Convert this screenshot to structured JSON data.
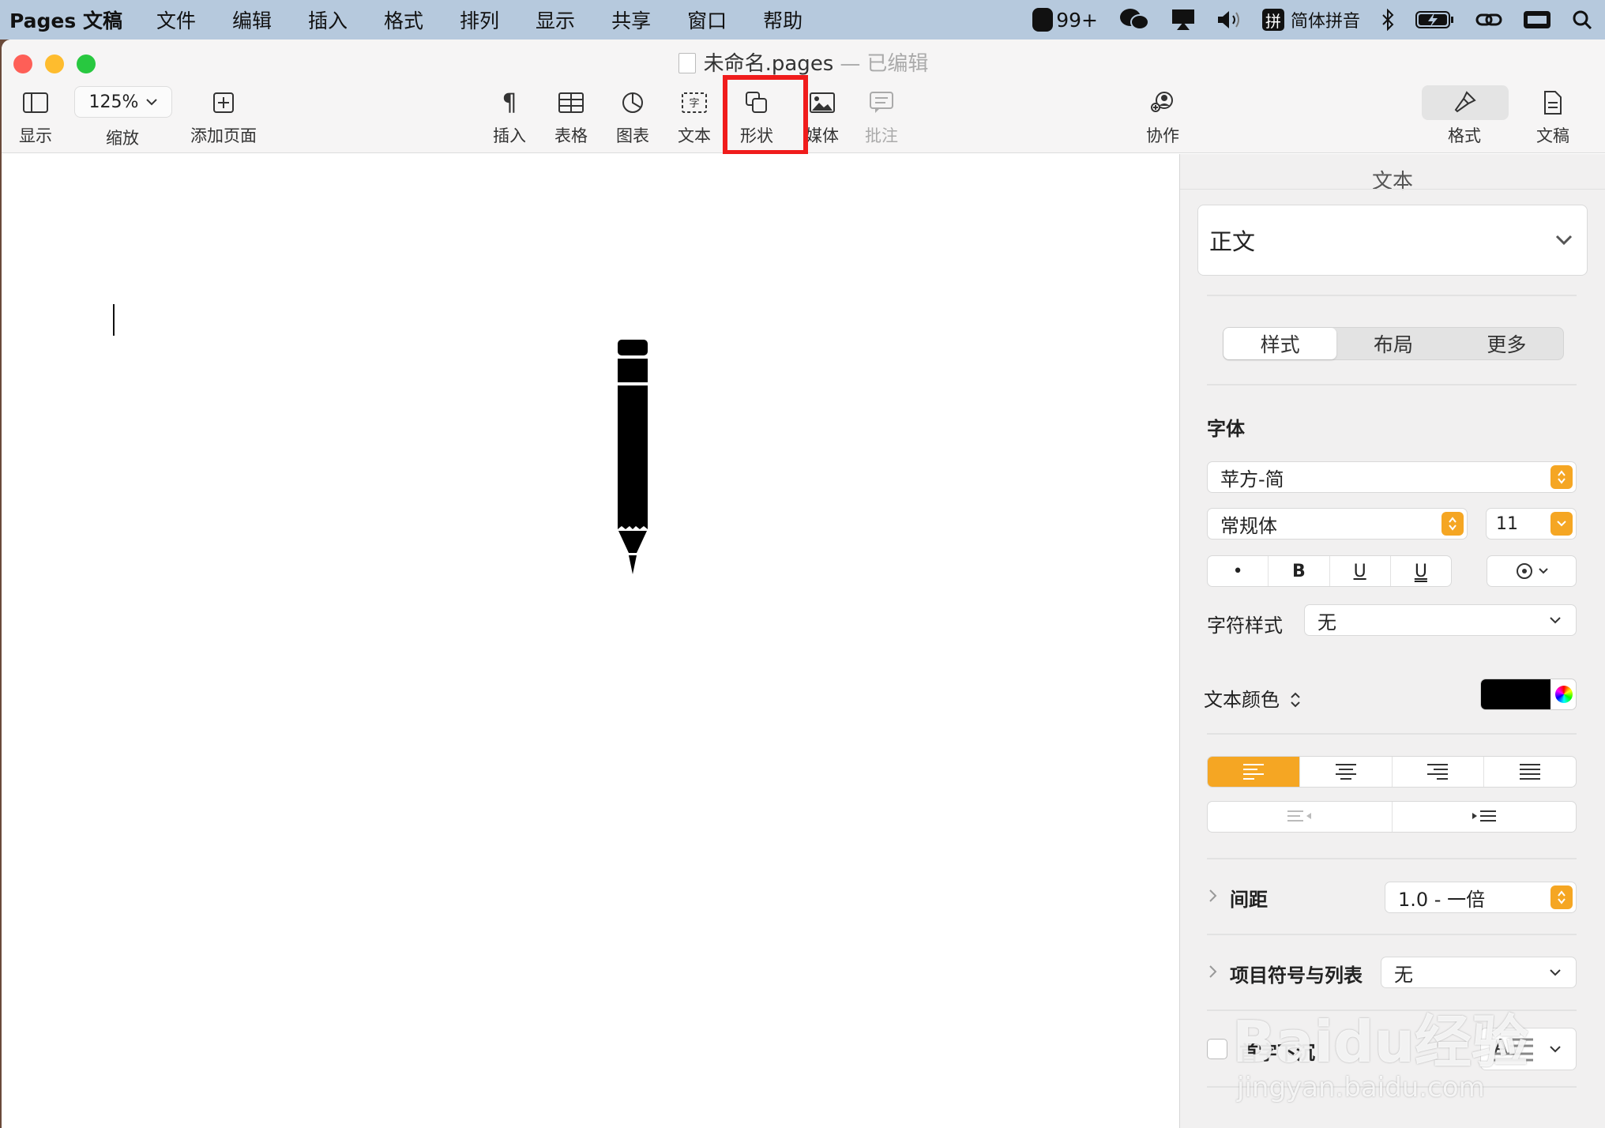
{
  "menubar": {
    "app": "Pages 文稿",
    "items": [
      "文件",
      "编辑",
      "插入",
      "格式",
      "排列",
      "显示",
      "共享",
      "窗口",
      "帮助"
    ],
    "status": {
      "badge": "99+",
      "ime": "简体拼音",
      "ime_glyph": "拼"
    }
  },
  "window": {
    "title": "未命名.pages",
    "title_sep": "—",
    "title_status": "已编辑"
  },
  "toolbar": {
    "view": "显示",
    "zoom_value": "125%",
    "zoom": "缩放",
    "add_page": "添加页面",
    "insert": "插入",
    "table": "表格",
    "chart": "图表",
    "text": "文本",
    "shape": "形状",
    "media": "媒体",
    "comment": "批注",
    "collaborate": "协作",
    "format": "格式",
    "document": "文稿"
  },
  "panel": {
    "header": "文本",
    "paragraph_style": "正文",
    "tabs": [
      "样式",
      "布局",
      "更多"
    ],
    "font_label": "字体",
    "font_family": "苹方-简",
    "font_weight": "常规体",
    "font_size": "11",
    "style_bullet": "•",
    "style_bold": "B",
    "style_italic": "U",
    "style_underline": "U",
    "char_style_label": "字符样式",
    "char_style_value": "无",
    "text_color_label": "文本颜色",
    "text_color": "#000000",
    "spacing_label": "间距",
    "spacing_value": "1.0 - 一倍",
    "bullets_label": "项目符号与列表",
    "bullets_value": "无",
    "dropcap_label": "首字下沉"
  },
  "watermark": {
    "brand": "Baidu经验",
    "url": "jingyan.baidu.com"
  },
  "colors": {
    "accent": "#f5a623",
    "highlight": "#f01c1c"
  }
}
